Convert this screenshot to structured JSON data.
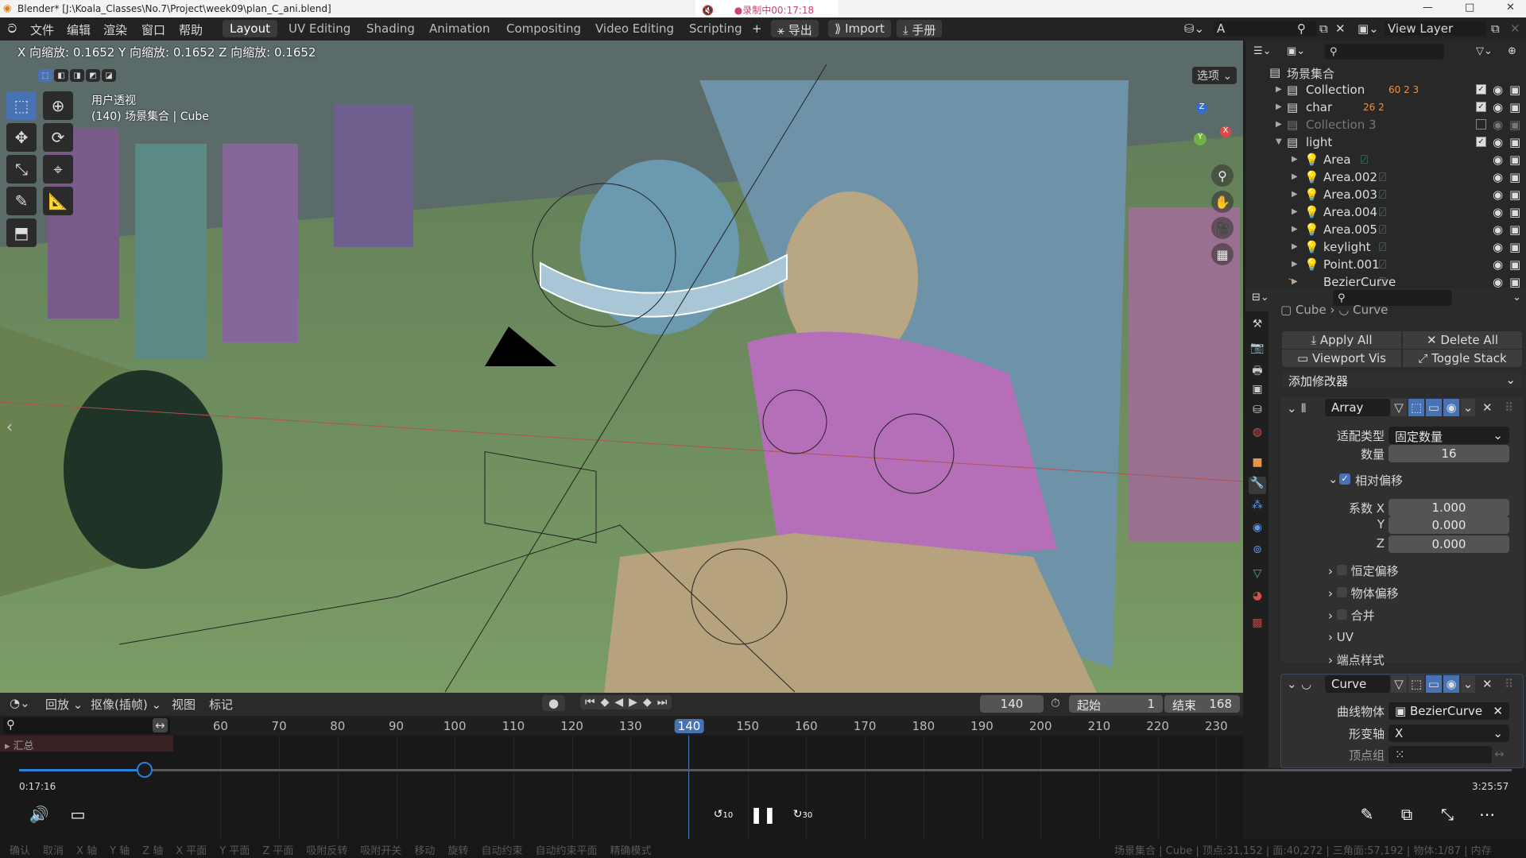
{
  "titlebar": {
    "title": "Blender* [J:\\Koala_Classes\\No.7\\Project\\week09\\plan_C_ani.blend]",
    "recording": "●录制中00:17:18",
    "min": "—",
    "max": "□",
    "close": "✕"
  },
  "menu": {
    "items": [
      "文件",
      "编辑",
      "渲染",
      "窗口",
      "帮助"
    ],
    "workspaces": [
      "Layout",
      "UV Editing",
      "Shading",
      "Animation",
      "Compositing",
      "Video Editing",
      "Scripting"
    ],
    "active_workspace": "Layout",
    "add": "+",
    "export": "导出",
    "import": "Import",
    "manual": "手册",
    "scene": "A",
    "view_layer": "View Layer"
  },
  "viewport": {
    "operator_info": "X 向缩放: 0.1652   Y 向缩放: 0.1652  Z 向缩放: 0.1652",
    "view_name": "用户透视",
    "object_info": "(140) 场景集合 | Cube",
    "options": "选项",
    "gizmo": {
      "x": "X",
      "y": "Y",
      "z": "Z"
    }
  },
  "outliner": {
    "root": "场景集合",
    "rows": [
      {
        "name": "Collection",
        "type": "collection",
        "badges": "60  2  3",
        "checked": true
      },
      {
        "name": "char",
        "type": "collection",
        "badges": "26  2",
        "checked": true
      },
      {
        "name": "Collection 3",
        "type": "collection",
        "badges": "",
        "checked": false,
        "disabled": true
      },
      {
        "name": "light",
        "type": "collection",
        "badges": "",
        "checked": true,
        "expanded": true
      },
      {
        "name": "Area",
        "type": "light"
      },
      {
        "name": "Area.002",
        "type": "light"
      },
      {
        "name": "Area.003",
        "type": "light"
      },
      {
        "name": "Area.004",
        "type": "light"
      },
      {
        "name": "Area.005",
        "type": "light"
      },
      {
        "name": "keylight",
        "type": "light"
      },
      {
        "name": "Point.001",
        "type": "light"
      },
      {
        "name": "BezierCurve",
        "type": "curve"
      }
    ]
  },
  "properties": {
    "breadcrumb": [
      "Cube",
      "Curve"
    ],
    "apply_all": "Apply All",
    "delete_all": "Delete All",
    "viewport_vis": "Viewport Vis",
    "toggle_stack": "Toggle Stack",
    "add_modifier": "添加修改器",
    "array": {
      "name": "Array",
      "fit_type_label": "适配类型",
      "fit_type": "固定数量",
      "count_label": "数量",
      "count": "16",
      "relative_offset": "相对偏移",
      "relative_checked": true,
      "factor_x_label": "系数 X",
      "factor_x": "1.000",
      "y_label": "Y",
      "factor_y": "0.000",
      "z_label": "Z",
      "factor_z": "0.000",
      "constant_offset": "恒定偏移",
      "object_offset": "物体偏移",
      "merge": "合并",
      "uv": "UV",
      "caps": "端点样式"
    },
    "curve": {
      "name": "Curve",
      "curve_object_label": "曲线物体",
      "curve_object": "BezierCurve",
      "deform_axis_label": "形变轴",
      "deform_axis": "X",
      "vertex_group_label": "顶点组"
    }
  },
  "timeline": {
    "menus": [
      "回放",
      "抠像(插帧)",
      "视图",
      "标记"
    ],
    "current_frame": "140",
    "start_label": "起始",
    "start": "1",
    "end_label": "结束",
    "end": "168",
    "ticks": [
      "60",
      "70",
      "80",
      "90",
      "100",
      "110",
      "120",
      "130",
      "140",
      "150",
      "160",
      "170",
      "180",
      "190",
      "200",
      "210",
      "220",
      "230"
    ],
    "summary": "汇总"
  },
  "player": {
    "elapsed": "0:17:16",
    "total": "3:25:57",
    "progress": 0.084,
    "rewind": "10",
    "forward": "30"
  },
  "statusbar": {
    "items": [
      "确认",
      "取消",
      "X 轴",
      "Y 轴",
      "Z 轴",
      "X 平面",
      "Y 平面",
      "Z 平面",
      "吸附反转",
      "吸附开关",
      "移动",
      "旋转",
      "自动约束",
      "自动约束平面",
      "精确模式"
    ],
    "stats": "场景集合 | Cube | 顶点:31,152 | 面:40,272 | 三角面:57,192 | 物体:1/87 | 内存"
  },
  "colors": {
    "accent": "#4772b3",
    "light_icon": "#e8944a",
    "data_icon": "#27a07d",
    "active_frame": "#4772b3"
  }
}
